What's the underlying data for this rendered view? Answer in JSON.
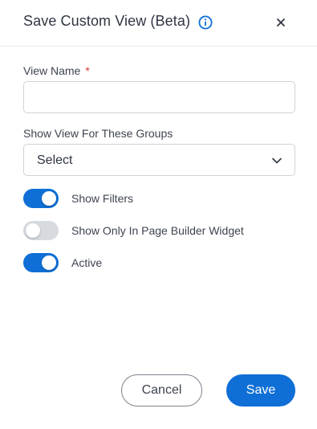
{
  "dialog": {
    "title": "Save Custom View (Beta)",
    "info_icon": "info-circle-icon",
    "close_icon": "close-icon"
  },
  "form": {
    "view_name": {
      "label": "View Name",
      "required_marker": "*",
      "value": "",
      "placeholder": ""
    },
    "groups": {
      "label": "Show View For These Groups",
      "selected": "Select",
      "icon": "chevron-down-icon"
    },
    "toggles": [
      {
        "label": "Show Filters",
        "on": true
      },
      {
        "label": "Show Only In Page Builder Widget",
        "on": false
      },
      {
        "label": "Active",
        "on": true
      }
    ]
  },
  "footer": {
    "cancel_label": "Cancel",
    "save_label": "Save"
  },
  "colors": {
    "accent": "#0f6fd6",
    "required": "#d63a3a",
    "toggle_off": "#d7dbe0"
  }
}
